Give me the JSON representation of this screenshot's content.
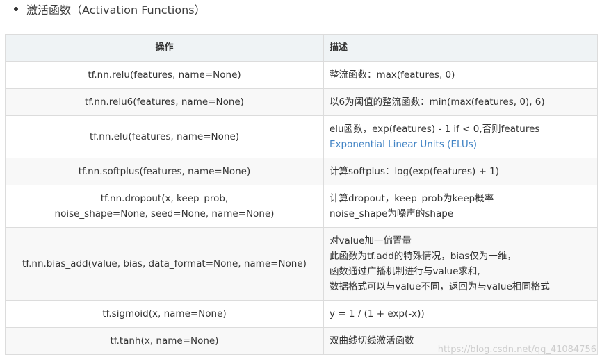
{
  "heading": "激活函数（Activation Functions）",
  "table": {
    "headers": [
      "操作",
      "描述"
    ],
    "rows": [
      {
        "func": [
          "tf.nn.relu(features, name=None)"
        ],
        "desc": [
          "整流函数：max(features, 0)"
        ],
        "h": 39
      },
      {
        "func": [
          "tf.nn.relu6(features, name=None)"
        ],
        "desc": [
          "以6为阈值的整流函数：min(max(features, 0), 6)"
        ],
        "h": 39
      },
      {
        "func": [
          "tf.nn.elu(features, name=None)"
        ],
        "desc": [
          "elu函数，exp(features) - 1 if < 0,否则features",
          "Exponential Linear Units (ELUs)"
        ],
        "link_line": 1,
        "h": 61
      },
      {
        "func": [
          "tf.nn.softplus(features, name=None)"
        ],
        "desc": [
          "计算softplus：log(exp(features) + 1)"
        ],
        "h": 39
      },
      {
        "func": [
          "tf.nn.dropout(x, keep_prob,",
          "noise_shape=None, seed=None, name=None)"
        ],
        "desc": [
          "计算dropout，keep_prob为keep概率",
          "noise_shape为噪声的shape"
        ],
        "h": 61
      },
      {
        "func": [
          "tf.nn.bias_add(value, bias, data_format=None, name=None)"
        ],
        "desc": [
          "对value加一偏置量",
          "此函数为tf.add的特殊情况，bias仅为一维，",
          "函数通过广播机制进行与value求和,",
          "数据格式可以与value不同，返回为与value相同格式"
        ],
        "h": 105
      },
      {
        "func": [
          "tf.sigmoid(x, name=None)"
        ],
        "desc": [
          "y = 1 / (1 + exp(-x))"
        ],
        "h": 39
      },
      {
        "func": [
          "tf.tanh(x, name=None)"
        ],
        "desc": [
          "双曲线切线激活函数"
        ],
        "h": 39
      }
    ]
  },
  "watermark": "https://blog.csdn.net/qq_41084756"
}
